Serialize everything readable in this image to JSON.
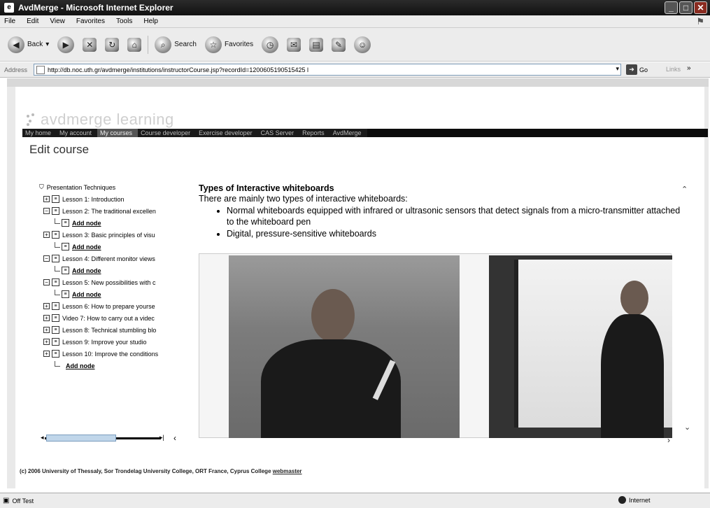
{
  "window": {
    "title": "AvdMerge - Microsoft Internet Explorer",
    "app_icon": "ie-icon"
  },
  "menu": [
    "File",
    "Edit",
    "View",
    "Favorites",
    "Tools",
    "Help"
  ],
  "toolbar": {
    "back": "Back",
    "search": "Search",
    "favorites": "Favorites"
  },
  "address": {
    "label": "Address",
    "url": "http://db.noc.uth.gr/avdmerge/institutions/instructorCourse.jsp?recordId=1200605190515425 l",
    "go": "Go",
    "links": "Links"
  },
  "site": {
    "logo": "avdmerge learning",
    "nav": [
      "My home",
      "My account",
      "My courses",
      "Course developer",
      "Exercise developer",
      "CAS Server",
      "Reports",
      "AvdMerge"
    ],
    "nav_active_index": 2,
    "page_title": "Edit course"
  },
  "tree": {
    "root": "Presentation Techniques",
    "add_label": "Add node",
    "items": [
      {
        "label": "Lesson 1: Introduction",
        "expanded": false,
        "has_add": false
      },
      {
        "label": "Lesson 2: The traditional excellen",
        "expanded": true,
        "has_add": true
      },
      {
        "label": "Lesson 3: Basic principles of visu",
        "expanded": false,
        "has_add": true
      },
      {
        "label": "Lesson 4: Different monitor views",
        "expanded": true,
        "has_add": true
      },
      {
        "label": "Lesson 5: New possibilities with c",
        "expanded": true,
        "has_add": true
      },
      {
        "label": "Lesson 6: How to prepare yourse",
        "expanded": false,
        "has_add": false
      },
      {
        "label": "Video 7: How to carry out a videc",
        "expanded": false,
        "has_add": false
      },
      {
        "label": "Lesson 8: Technical stumbling blo",
        "expanded": false,
        "has_add": false
      },
      {
        "label": "Lesson 9: Improve your studio",
        "expanded": false,
        "has_add": false
      },
      {
        "label": "Lesson 10: Improve the conditions",
        "expanded": false,
        "has_add": false
      }
    ]
  },
  "content": {
    "heading": "Types of Interactive whiteboards",
    "intro": "There are mainly two types of interactive whiteboards:",
    "bullets": [
      "Normal whiteboards equipped with infrared or ultrasonic sensors that detect signals from a micro-transmitter attached to the whiteboard pen",
      "Digital, pressure-sensitive whiteboards"
    ]
  },
  "footer": {
    "text": "(c) 2006 University of Thessaly, Sor Trondelag University College, ORT France, Cyprus College",
    "link": "webmaster"
  },
  "status": {
    "text": "Off Test",
    "zone": "Internet"
  }
}
